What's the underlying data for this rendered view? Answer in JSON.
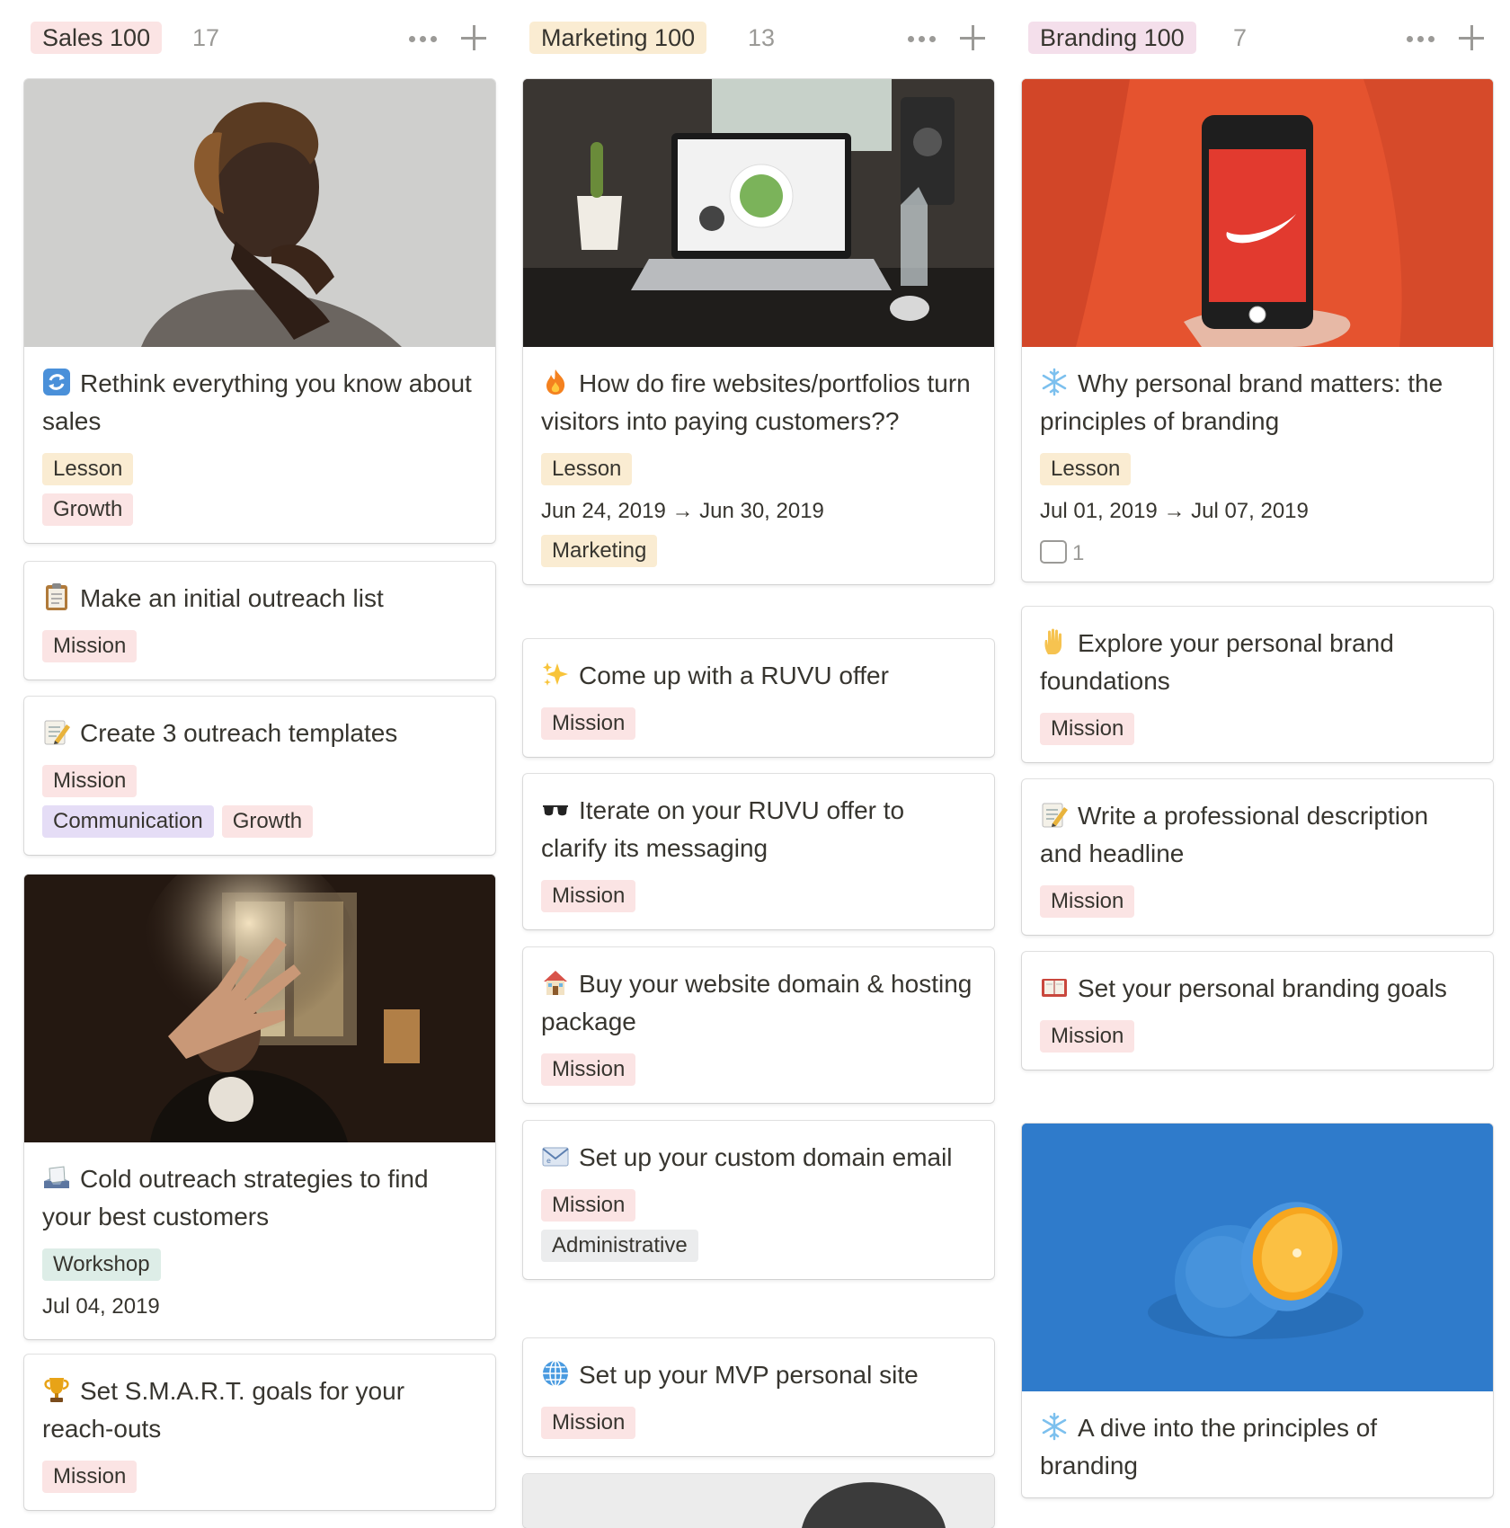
{
  "columns": [
    {
      "name": "Sales 100",
      "count": "17",
      "color": "#fbe4e4",
      "cards": [
        {
          "emoji": "arrows-cycle-icon",
          "title": "Rethink everything you know about sales",
          "tags": [
            "Lesson",
            "Growth"
          ]
        },
        {
          "emoji": "clipboard-icon",
          "title": "Make an initial outreach list",
          "tags": [
            "Mission"
          ]
        },
        {
          "emoji": "memo-icon",
          "title": "Create 3 outreach templates",
          "tags": [
            "Mission",
            "Communication",
            "Growth"
          ]
        },
        {
          "emoji": "outbox-tray-icon",
          "title": "Cold outreach strategies to find your best customers",
          "tags": [
            "Workshop"
          ],
          "date": "Jul 04, 2019"
        },
        {
          "emoji": "trophy-icon",
          "title": "Set S.M.A.R.T. goals for your reach-outs",
          "tags": [
            "Mission"
          ]
        }
      ]
    },
    {
      "name": "Marketing 100",
      "count": "13",
      "color": "#faecd2",
      "cards": [
        {
          "emoji": "fire-icon",
          "title": "How do fire websites/portfolios turn visitors into paying customers??",
          "tags": [
            "Lesson"
          ],
          "date": "Jun 24, 2019 → Jun 30, 2019",
          "tags2": [
            "Marketing"
          ]
        },
        {
          "emoji": "sparkles-icon",
          "title": "Come up with a RUVU offer",
          "tags": [
            "Mission"
          ]
        },
        {
          "emoji": "sunglasses-icon",
          "title": "Iterate on your RUVU offer to clarify its messaging",
          "tags": [
            "Mission"
          ]
        },
        {
          "emoji": "house-icon",
          "title": "Buy your website domain & hosting package",
          "tags": [
            "Mission"
          ]
        },
        {
          "emoji": "email-icon",
          "title": "Set up your custom domain email",
          "tags": [
            "Mission",
            "Administrative"
          ]
        },
        {
          "emoji": "globe-icon",
          "title": "Set up your MVP personal site",
          "tags": [
            "Mission"
          ]
        }
      ]
    },
    {
      "name": "Branding 100",
      "count": "7",
      "color": "#f4dfeb",
      "cards": [
        {
          "emoji": "snowflake-icon",
          "title": "Why personal brand matters: the principles of branding",
          "tags": [
            "Lesson"
          ],
          "date": "Jul 01, 2019 → Jul 07, 2019",
          "comments": "1"
        },
        {
          "emoji": "raised-hand-icon",
          "title": "Explore your personal brand foundations",
          "tags": [
            "Mission"
          ]
        },
        {
          "emoji": "memo-icon",
          "title": "Write a professional description and headline",
          "tags": [
            "Mission"
          ]
        },
        {
          "emoji": "ledger-icon",
          "title": "Set your personal branding goals",
          "tags": [
            "Mission"
          ]
        },
        {
          "emoji": "snowflake-icon",
          "title": "A dive into the principles of branding",
          "tags": []
        }
      ]
    }
  ]
}
